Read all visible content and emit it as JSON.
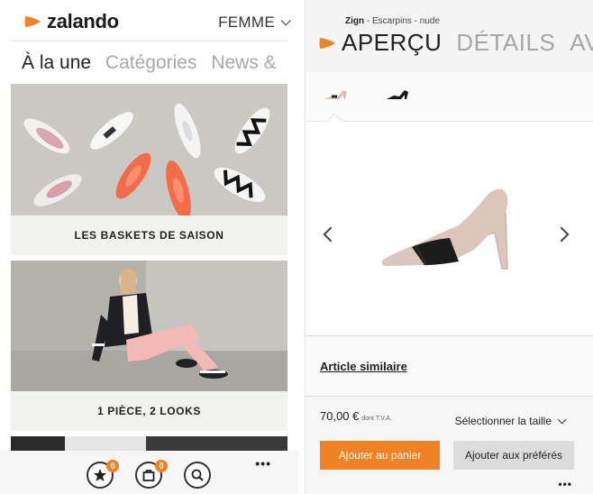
{
  "left": {
    "brand": "zalando",
    "gender_selector": "FEMME",
    "nav_tabs": [
      {
        "label": "À la une",
        "active": true
      },
      {
        "label": "Catégories",
        "active": false
      },
      {
        "label": "News &",
        "active": false
      }
    ],
    "promos": [
      {
        "caption": "LES BASKETS DE SAISON"
      },
      {
        "caption": "1 PIÈCE, 2 LOOKS"
      }
    ],
    "appbar": {
      "wishlist_icon": "star-icon",
      "wishlist_count": "0",
      "cart_icon": "bag-icon",
      "cart_count": "0",
      "search_icon": "search-icon",
      "more": "•••"
    }
  },
  "right": {
    "breadcrumb": {
      "brand": "Zign",
      "sep": " - ",
      "category": "Escarpins",
      "sep2": " - ",
      "color": "nude"
    },
    "pivots": [
      {
        "label": "APERÇU",
        "active": true
      },
      {
        "label": "DÉTAILS",
        "active": false
      },
      {
        "label": "AVIS",
        "active": false
      }
    ],
    "similar_label": "Article similaire",
    "price": "70,00 €",
    "price_note": "dont T.V.A.",
    "size_selector": "Sélectionner la taille",
    "add_to_cart": "Ajouter au panier",
    "add_to_favorites": "Ajouter aux préférés",
    "more": "•••"
  },
  "colors": {
    "accent": "#f08226",
    "text": "#222222",
    "muted": "#a9a9a9"
  }
}
